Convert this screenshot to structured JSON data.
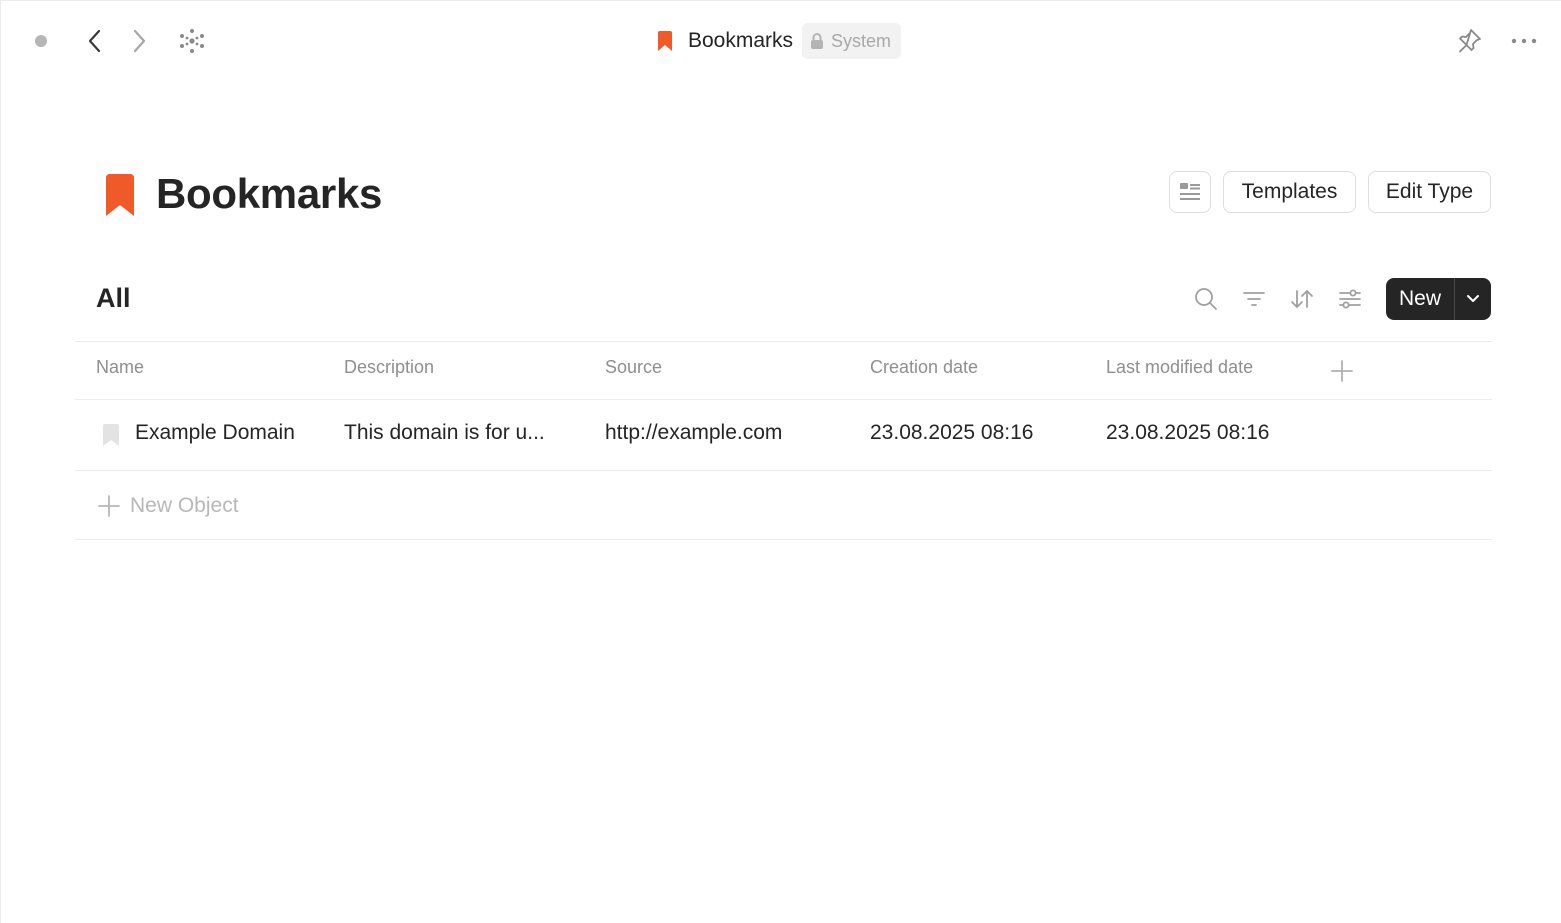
{
  "topbar": {
    "breadcrumb_title": "Bookmarks",
    "badge_label": "System"
  },
  "header": {
    "title": "Bookmarks",
    "templates_label": "Templates",
    "edit_type_label": "Edit Type"
  },
  "view": {
    "title": "All",
    "new_label": "New"
  },
  "table": {
    "columns": [
      "Name",
      "Description",
      "Source",
      "Creation date",
      "Last modified date"
    ],
    "rows": [
      {
        "name": "Example Domain",
        "description": "This domain is for u...",
        "source": "http://example.com",
        "created": "23.08.2025 08:16",
        "modified": "23.08.2025 08:16"
      }
    ],
    "new_object_label": "New Object"
  },
  "colors": {
    "accent": "#f05a28",
    "text": "#252525",
    "muted": "#8f8f8f",
    "button_dark": "#252525"
  },
  "icons": [
    "status-dot",
    "chevron-left-icon",
    "chevron-right-icon",
    "graph-icon",
    "bookmark-icon",
    "lock-icon",
    "pin-icon",
    "more-icon",
    "layout-icon",
    "search-icon",
    "filter-icon",
    "sort-icon",
    "settings-icon",
    "chevron-down-icon",
    "plus-icon"
  ]
}
